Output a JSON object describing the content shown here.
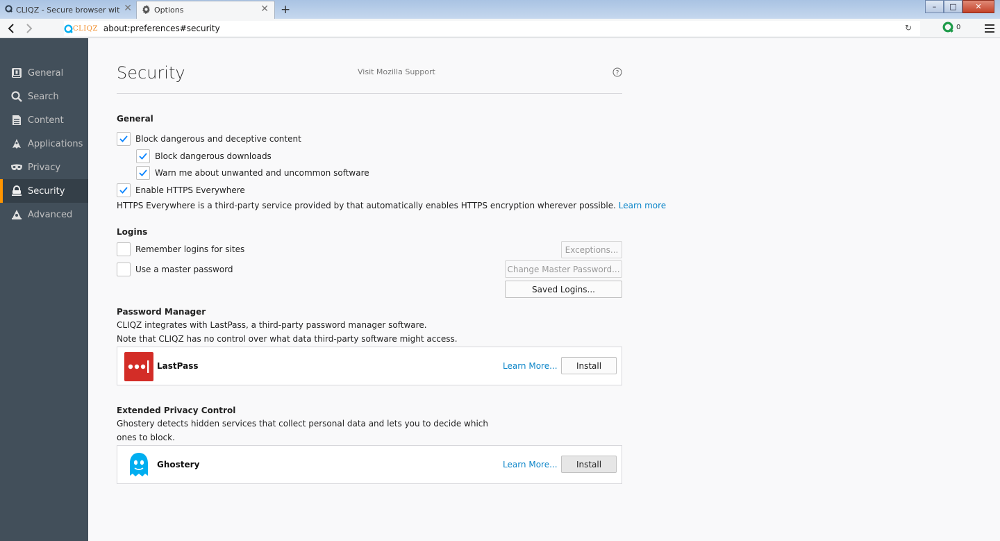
{
  "tabs": [
    {
      "title": "CLIQZ - Secure browser with b...",
      "active": false
    },
    {
      "title": "Options",
      "active": true
    }
  ],
  "window_controls": {
    "minimize": "–",
    "maximize": "□",
    "close": "✕"
  },
  "urlbar": {
    "brand": "CLIQZ",
    "url": "about:preferences#security"
  },
  "toolbar": {
    "cliqz_count": "0"
  },
  "sidebar": {
    "items": [
      {
        "label": "General",
        "icon": "general-icon"
      },
      {
        "label": "Search",
        "icon": "search-icon"
      },
      {
        "label": "Content",
        "icon": "content-icon"
      },
      {
        "label": "Applications",
        "icon": "applications-icon"
      },
      {
        "label": "Privacy",
        "icon": "privacy-mask-icon"
      },
      {
        "label": "Security",
        "icon": "lock-icon",
        "selected": true
      },
      {
        "label": "Advanced",
        "icon": "advanced-icon"
      }
    ]
  },
  "page": {
    "title": "Security",
    "support_link": "Visit Mozilla Support",
    "help_icon": "help-icon"
  },
  "general": {
    "title": "General",
    "block_content": "Block dangerous and deceptive content",
    "block_downloads": "Block dangerous downloads",
    "warn_software": "Warn me about unwanted and uncommon software",
    "https_everywhere": "Enable HTTPS Everywhere",
    "https_desc": "HTTPS Everywhere is a third-party service provided by that automatically enables HTTPS encryption wherever possible.",
    "learn_more": "Learn more"
  },
  "logins": {
    "title": "Logins",
    "remember": "Remember logins for sites",
    "master_password": "Use a master password",
    "exceptions_button": "Exceptions...",
    "change_master_button": "Change Master Password...",
    "saved_logins_button": "Saved Logins..."
  },
  "password_manager": {
    "title": "Password Manager",
    "desc1": "CLIQZ integrates with LastPass, a third-party password manager software.",
    "desc2": "Note that CLIQZ has no control over what data third-party software might access.",
    "addon_name": "LastPass",
    "learn_more": "Learn More...",
    "install": "Install"
  },
  "privacy_control": {
    "title": "Extended Privacy Control",
    "desc1": "Ghostery detects hidden services that collect personal data and lets you to decide which",
    "desc2": "ones to block.",
    "addon_name": "Ghostery",
    "learn_more": "Learn More...",
    "install": "Install"
  },
  "colors": {
    "sidebar_bg": "#424f5a",
    "sidebar_selected": "#343f48",
    "accent_orange": "#ff9500",
    "link_blue": "#0a84c8",
    "check_blue": "#0a84ff",
    "lastpass_red": "#d32d27",
    "ghostery_blue": "#00aef0"
  }
}
